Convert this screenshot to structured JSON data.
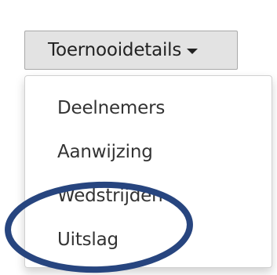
{
  "dropdown": {
    "label": "Toernooidetails",
    "menu_items": [
      {
        "label": "Deelnemers"
      },
      {
        "label": "Aanwijzing"
      },
      {
        "label": "Wedstrijden"
      },
      {
        "label": "Uitslag"
      }
    ]
  },
  "highlight": {
    "color": "#27457f",
    "target": "Uitslag"
  },
  "colors": {
    "button_bg": "#e3e3e3",
    "button_border": "#a9a9a9",
    "text": "#333333"
  }
}
